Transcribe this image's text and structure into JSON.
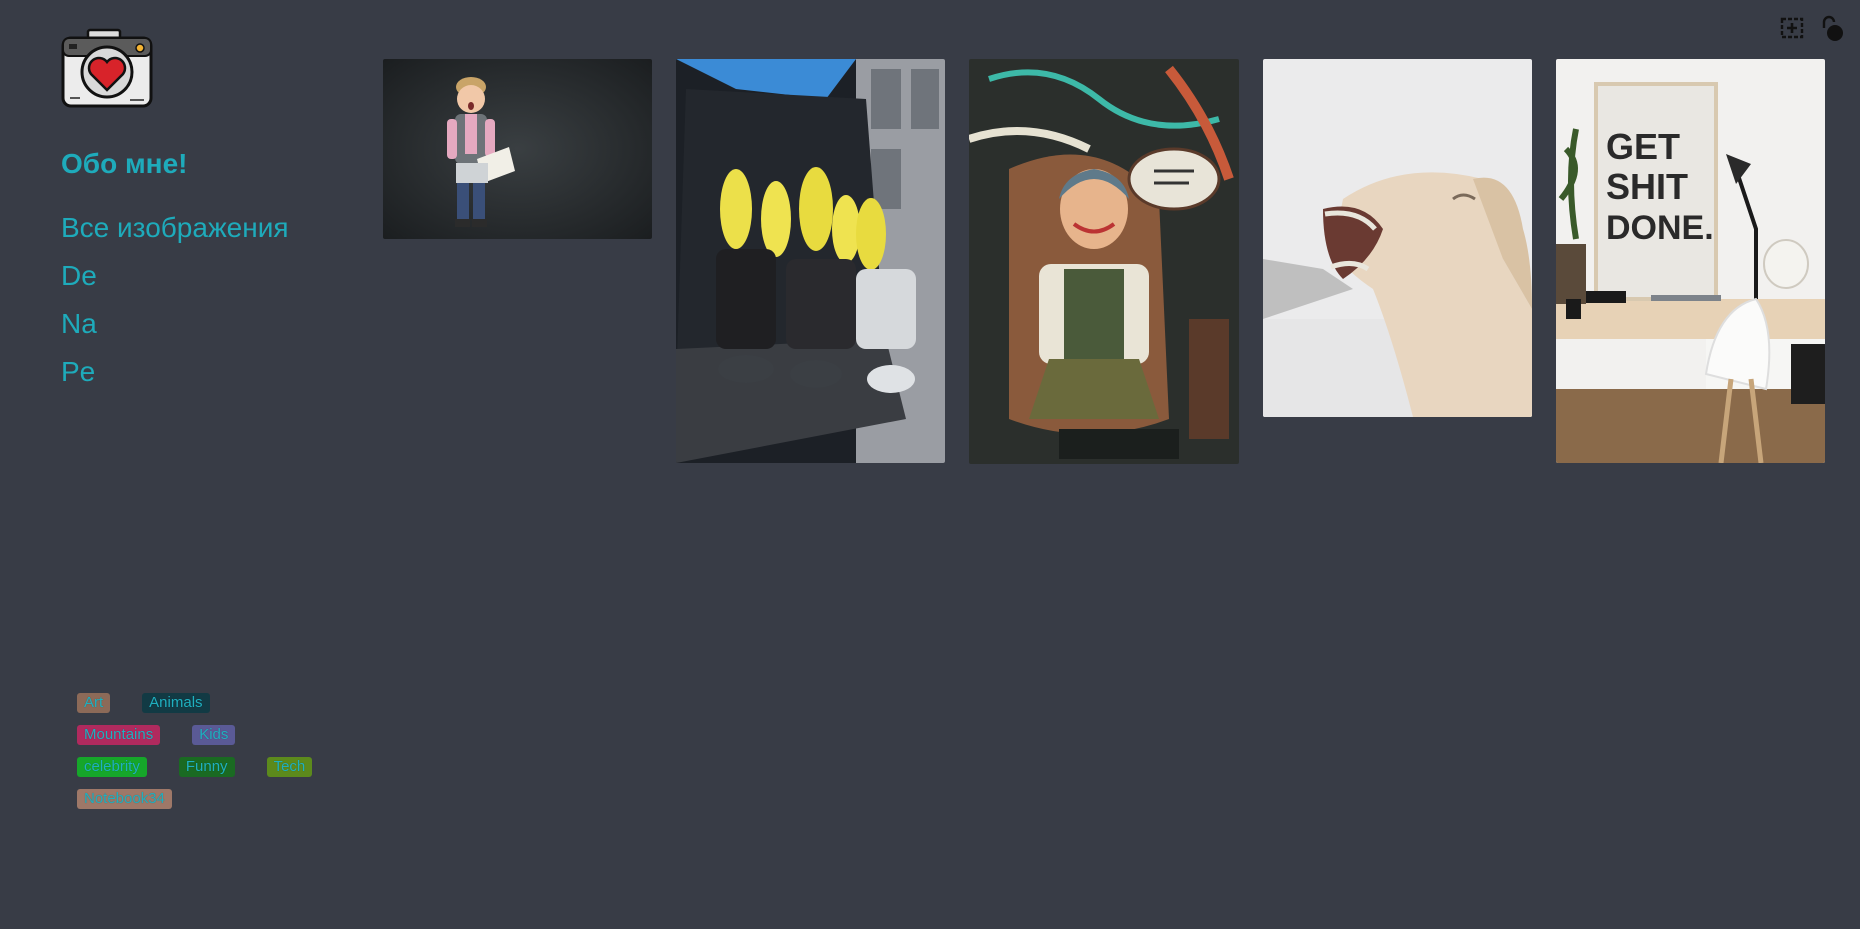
{
  "sidebar": {
    "logo_icon": "camera-heart-icon",
    "about_label": "Обо мне!",
    "nav": [
      "Все изображения",
      "De",
      "Na",
      "Pe"
    ]
  },
  "tags": [
    [
      {
        "label": "Art",
        "color": "#8c6a58"
      },
      {
        "label": "Animals",
        "color": "#123a44"
      }
    ],
    [
      {
        "label": "Mountains",
        "color": "#b02a5e"
      },
      {
        "label": "Kids",
        "color": "#5a5a96"
      }
    ],
    [
      {
        "label": "celebrity",
        "color": "#16a62a"
      },
      {
        "label": "Funny",
        "color": "#1a6a22"
      },
      {
        "label": "Tech",
        "color": "#5c8a1c"
      }
    ],
    [
      {
        "label": "Notebook34",
        "color": "#9e7868"
      }
    ]
  ],
  "header": {
    "icons": [
      "add-image-icon",
      "unlock-icon"
    ]
  },
  "gallery": [
    {
      "name": "kid-with-book-photo"
    },
    {
      "name": "banana-costumes-photo"
    },
    {
      "name": "street-art-woman-photo"
    },
    {
      "name": "laughing-horse-photo"
    },
    {
      "name": "desk-poster-photo",
      "caption": [
        "GET",
        "SHIT",
        "DONE."
      ]
    }
  ]
}
